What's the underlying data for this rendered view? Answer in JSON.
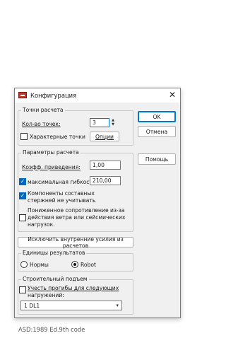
{
  "window": {
    "title": "Конфигурация",
    "close_glyph": "✕"
  },
  "buttons": {
    "ok": "OK",
    "cancel": "Отмена",
    "help": "Помощь"
  },
  "points_group": {
    "label": "Точки расчета",
    "count_label": "Кол-во точек:",
    "count_value": "3",
    "characteristic_label": "Характерные точки",
    "characteristic_checked": false,
    "options_button": "Опции"
  },
  "calc_params": {
    "label": "Параметры расчета",
    "coef_label": "Коэфф. приведения:",
    "coef_value": "1,00",
    "max_flex_label": "максимальная гибкость",
    "max_flex_checked": true,
    "max_flex_value": "210,00",
    "components_label_line1": "Компоненты составных",
    "components_label_line2": "стержней не учитывать",
    "components_checked": true,
    "reduced_label_line1": "Пониженное сопротивление из-за",
    "reduced_label_line2": "действия ветра или сейсмических",
    "reduced_label_line3": "нагрузок.",
    "reduced_checked": false
  },
  "exclude_button": "Исключить внутренние усилия из расчетов",
  "units": {
    "label": "Единицы результатов",
    "option_norms": "Нормы",
    "option_robot": "Robot",
    "selected": "Robot"
  },
  "camber": {
    "label": "Строительный подъем",
    "consider_label_line1": "Учесть прогибы для следующих",
    "consider_label_line2": "нагружений:",
    "consider_checked": false,
    "select_value": "1 DL1"
  },
  "footer": "ASD:1989 Ed.9th code",
  "colors": {
    "accent": "#0078d7",
    "checkbox_fill": "#0067c0",
    "app_icon": "#c0392b"
  }
}
